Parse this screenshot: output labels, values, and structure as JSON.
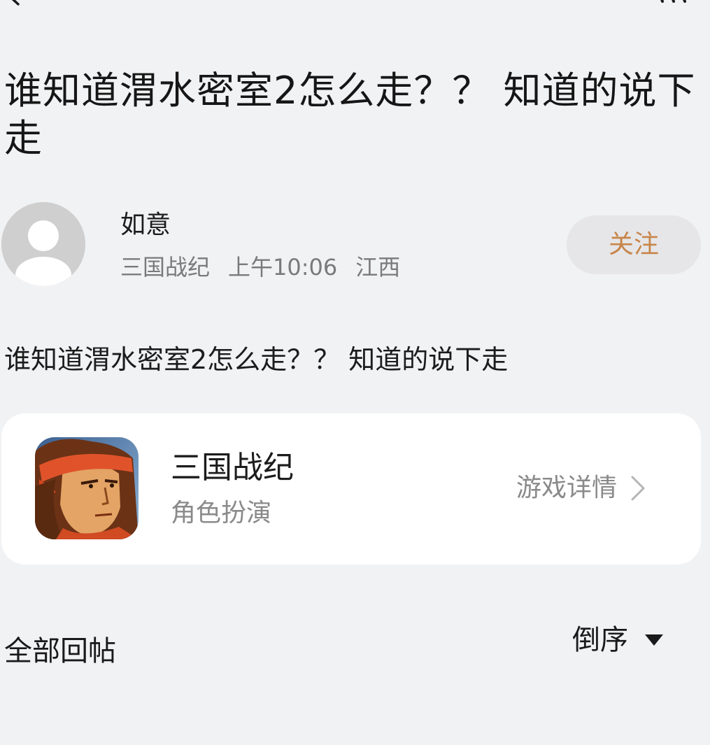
{
  "post": {
    "title": "谁知道渭水密室2怎么走？？ 知道的说下走",
    "body": "谁知道渭水密室2怎么走？？ 知道的说下走"
  },
  "author": {
    "name": "如意",
    "game": "三国战纪",
    "time": "上午10:06",
    "location": "江西",
    "follow_label": "关注"
  },
  "game_card": {
    "name": "三国战纪",
    "genre": "角色扮演",
    "detail_label": "游戏详情"
  },
  "replies": {
    "label": "全部回帖",
    "sort_label": "倒序"
  },
  "colors": {
    "background": "#f1f2f4",
    "follow_text": "#c8864a",
    "follow_bg": "#e6e6e8",
    "muted_text": "#7a7a7a",
    "card_bg": "#ffffff"
  },
  "icons": {
    "back": "back-arrow-icon",
    "more": "more-icon",
    "avatar": "default-avatar-icon",
    "chevron": "chevron-right-icon",
    "sort": "caret-down-icon"
  }
}
